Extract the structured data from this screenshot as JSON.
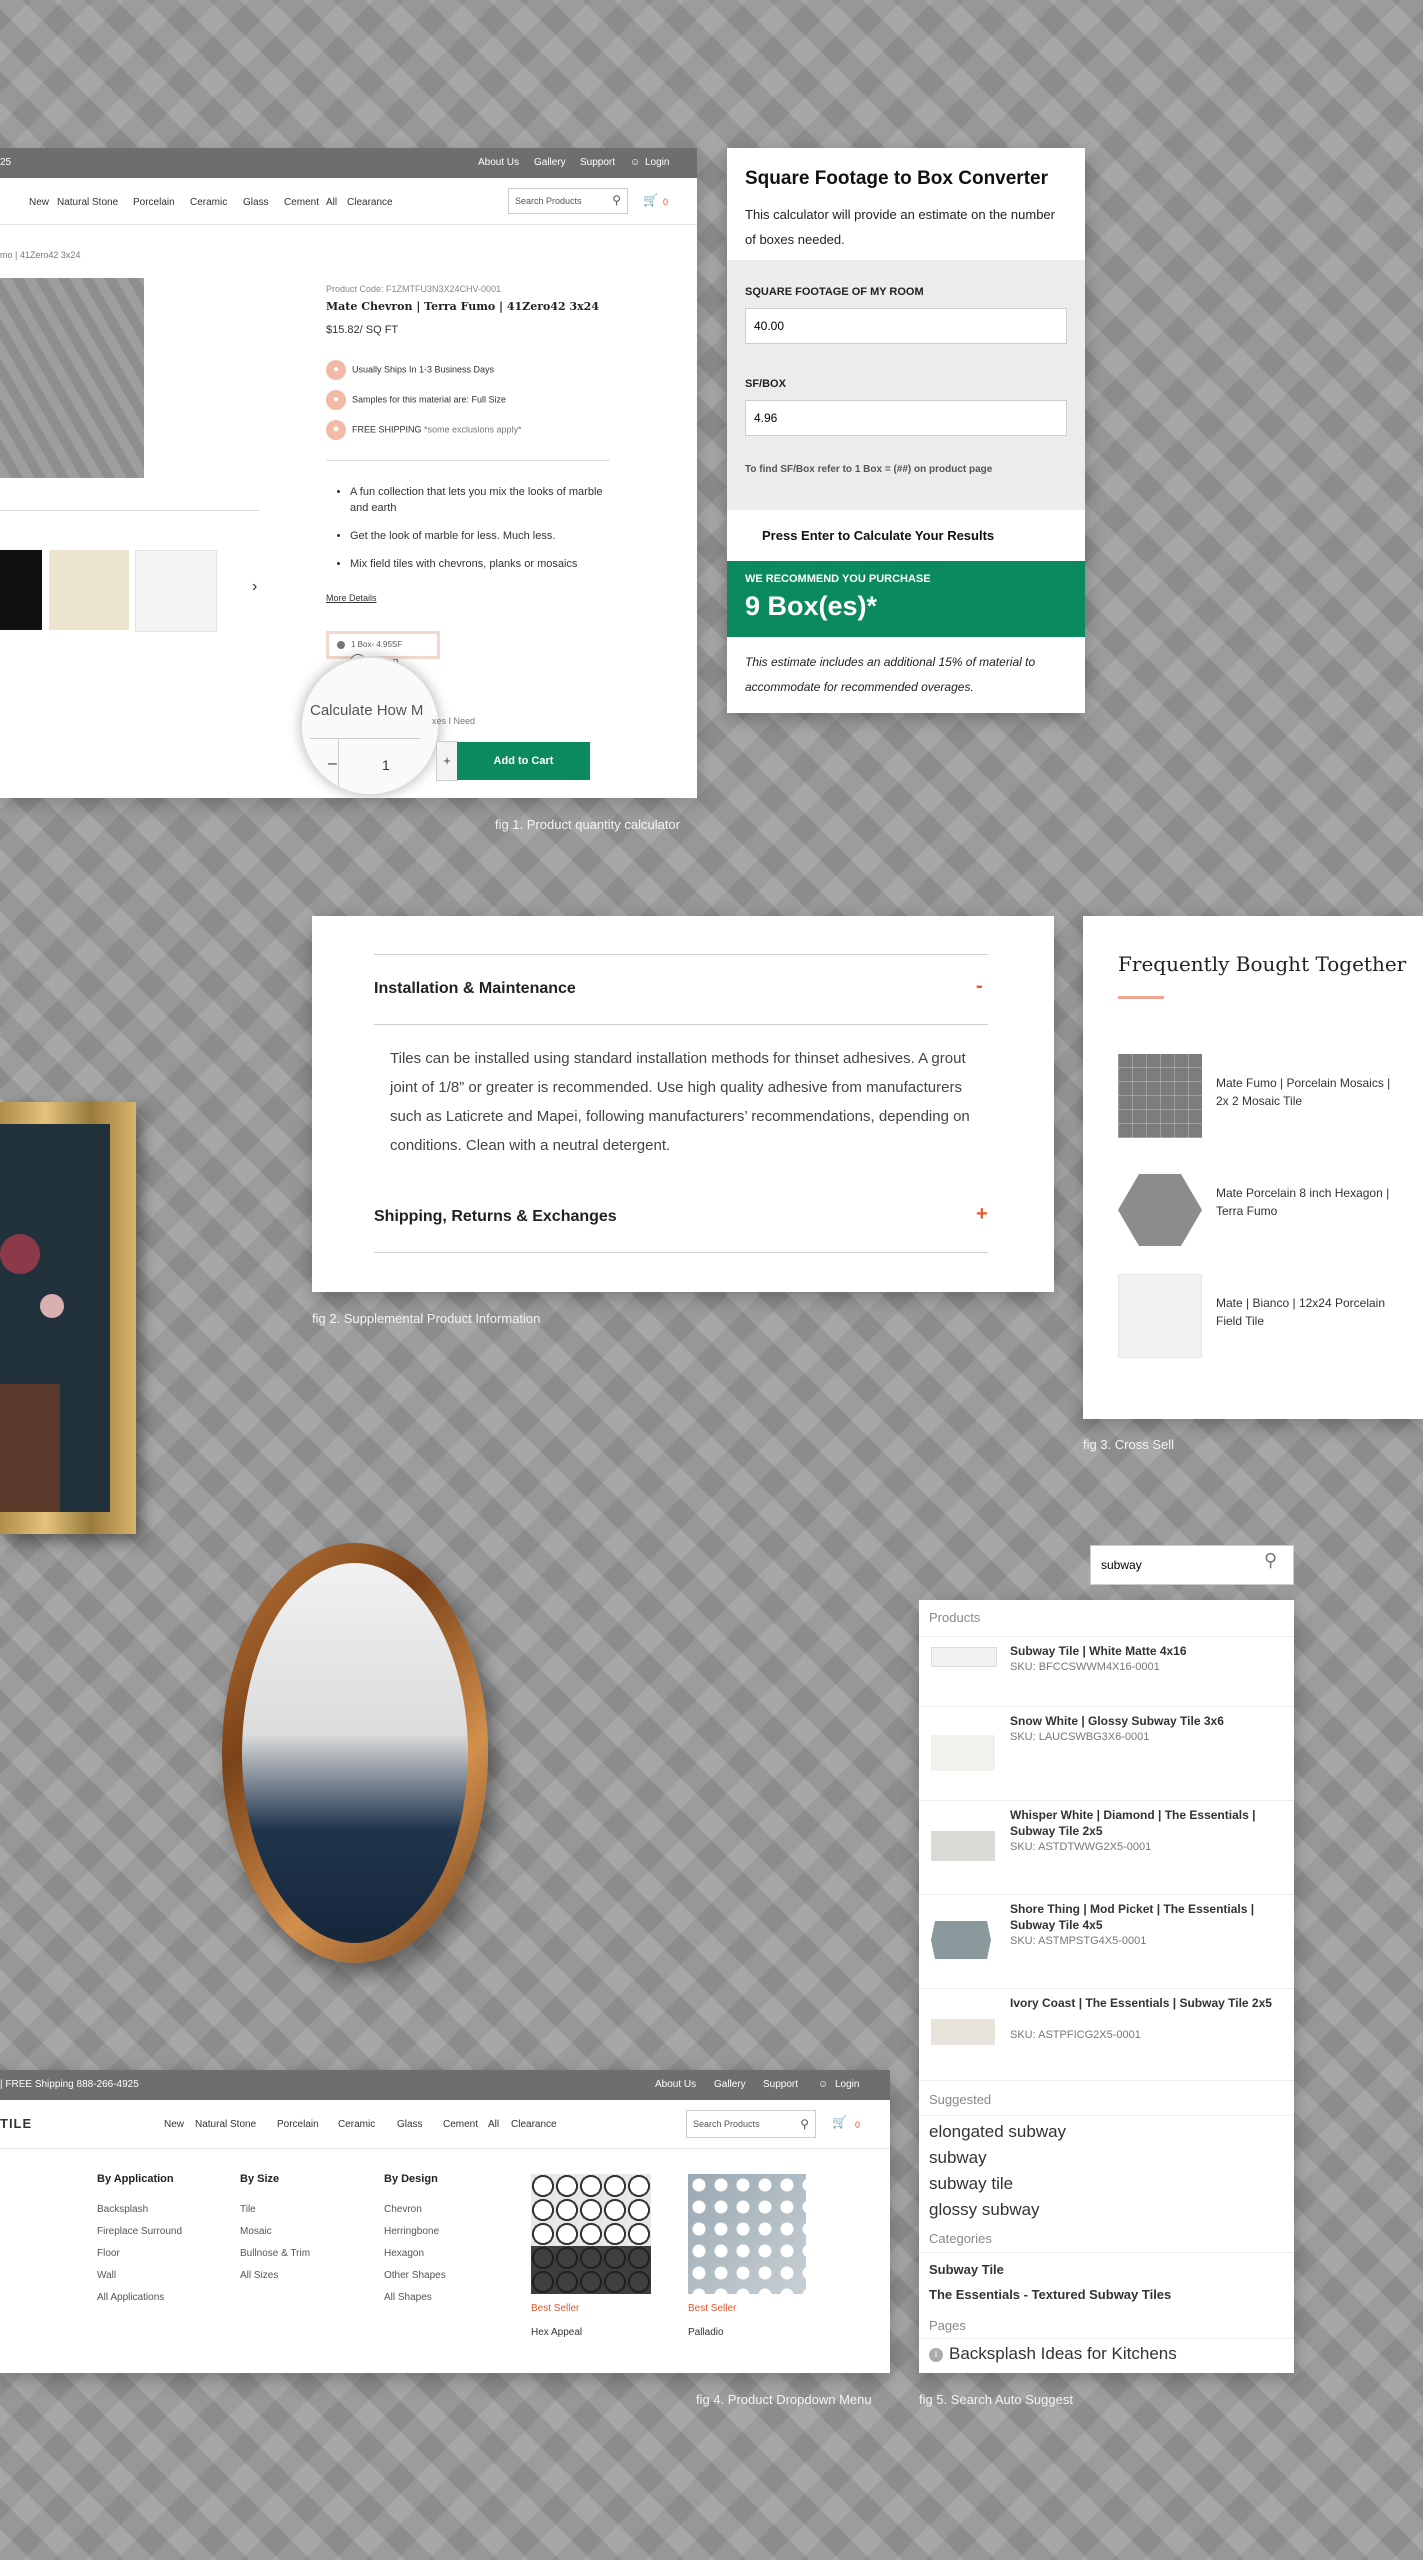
{
  "fig1": {
    "topbar": {
      "left_text": "25",
      "about": "About Us",
      "gallery": "Gallery",
      "support": "Support",
      "login": "Login"
    },
    "nav": [
      "New",
      "Natural Stone",
      "Porcelain",
      "Ceramic",
      "Glass",
      "Cement",
      "All",
      "Clearance"
    ],
    "search_placeholder": "Search Products",
    "cart_count": "0",
    "breadcrumb": "mo | 41Zero42 3x24",
    "product_code": "Product Code: F1ZMTFU3N3X24CHV-0001",
    "product_name": "Mate Chevron | Terra Fumo | 41Zero42 3x24",
    "price": "$15.82/ SQ FT",
    "features": [
      "Usually Ships In 1-3 Business Days",
      "Samples for this material are: Full Size"
    ],
    "shipping_bold": "FREE SHIPPING",
    "shipping_note": " *some exclusions apply*",
    "bullets": [
      "A fun collection that lets you mix the looks of marble and earth",
      "Get the look of marble for less. Much less.",
      "Mix field tiles with chevrons, planks or mosaics"
    ],
    "more_details": "More Details",
    "option_box": "1 Box- 4.95SF",
    "option_sample": "Samp",
    "calc_link_big": "Calculate How M",
    "calc_link_small": "xes I Need",
    "qty": "1",
    "minus": "–",
    "plus": "+",
    "next": "›",
    "add_to_cart": "Add to Cart",
    "caption": "fig 1. Product quantity calculator"
  },
  "calc": {
    "title": "Square Footage to Box Converter",
    "desc": "This calculator will provide an estimate on the number of boxes needed.",
    "label_sqft": "SQUARE FOOTAGE OF MY ROOM",
    "value_sqft": "40.00",
    "label_sfbox": "SF/BOX",
    "value_sfbox": "4.96",
    "hint": "To find SF/Box refer to 1 Box = (##) on product page",
    "press": "Press Enter to Calculate Your Results",
    "recommend_label": "WE RECOMMEND YOU PURCHASE",
    "recommend_value": "9 Box(es)*",
    "note": "This estimate includes an additional 15% of material to accommodate for recommended overages."
  },
  "fig2": {
    "section1": "Installation & Maintenance",
    "section1_sign": "-",
    "body": "Tiles can be installed using standard installation methods for thinset adhesives. A grout joint of 1/8” or greater is recommended. Use high quality adhesive from manufacturers such as Laticrete and Mapei, following manufacturers’ recommendations, depending on conditions. Clean with a neutral detergent.",
    "section2": "Shipping, Returns & Exchanges",
    "section2_sign": "+",
    "caption": "fig 2. Supplemental Product Information"
  },
  "fig3": {
    "title": "Frequently Bought Together",
    "items": [
      "Mate Fumo | Porcelain Mosaics | 2x 2 Mosaic Tile",
      "Mate Porcelain 8 inch Hexagon | Terra Fumo",
      "Mate | Bianco | 12x24 Porcelain Field Tile"
    ],
    "caption": "fig 3. Cross  Sell"
  },
  "search": {
    "query": "subway",
    "products_heading": "Products",
    "products": [
      {
        "name": "Subway Tile | White Matte 4x16",
        "sku": "SKU: BFCCSWWM4X16-0001"
      },
      {
        "name": "Snow White | Glossy Subway Tile 3x6",
        "sku": "SKU: LAUCSWBG3X6-0001"
      },
      {
        "name": "Whisper White | Diamond | The Essentials | Subway Tile 2x5",
        "sku": "SKU: ASTDTWWG2X5-0001"
      },
      {
        "name": "Shore Thing | Mod Picket | The Essentials | Subway Tile 4x5",
        "sku": "SKU: ASTMPSTG4X5-0001"
      },
      {
        "name": "Ivory Coast | The Essentials | Subway Tile 2x5",
        "sku": "SKU: ASTPFICG2X5-0001"
      }
    ],
    "suggested_heading": "Suggested",
    "suggested": [
      "elongated subway",
      "subway",
      "subway tile",
      "glossy subway"
    ],
    "categories_heading": "Categories",
    "categories": [
      "Subway Tile",
      "The Essentials - Textured Subway Tiles"
    ],
    "pages_heading": "Pages",
    "page": "Backsplash Ideas for Kitchens",
    "caption": "fig 5. Search Auto Suggest"
  },
  "fig4": {
    "topbar_left": "| FREE Shipping 888-266-4925",
    "about": "About Us",
    "gallery": "Gallery",
    "support": "Support",
    "login": "Login",
    "logo": "TILE",
    "nav": [
      "New",
      "Natural Stone",
      "Porcelain",
      "Ceramic",
      "Glass",
      "Cement",
      "All",
      "Clearance"
    ],
    "search_placeholder": "Search Products",
    "cart_count": "0",
    "columns": [
      {
        "title": "By Application",
        "items": [
          "Backsplash",
          "Fireplace Surround",
          "Floor",
          "Wall",
          "All Applications"
        ]
      },
      {
        "title": "By Size",
        "items": [
          "Tile",
          "Mosaic",
          "Bullnose & Trim",
          "All Sizes"
        ]
      },
      {
        "title": "By Design",
        "items": [
          "Chevron",
          "Herringbone",
          "Hexagon",
          "Other Shapes",
          "All Shapes"
        ]
      }
    ],
    "promos": [
      {
        "badge": "Best Seller",
        "name": "Hex Appeal"
      },
      {
        "badge": "Best Seller",
        "name": "Palladio"
      }
    ],
    "caption": "fig 4. Product Dropdown Menu"
  },
  "colors": {
    "accent_green": "#0b8a5f",
    "accent_orange": "#e4572e",
    "salmon": "#f2b9a7"
  }
}
